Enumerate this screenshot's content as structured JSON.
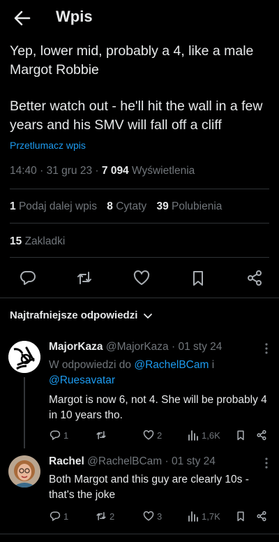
{
  "header": {
    "title": "Wpis",
    "back_icon": "arrow-left-icon"
  },
  "post": {
    "paragraphs": [
      "Yep, lower mid, probably a 4, like a male Margot Robbie",
      "Better watch out - he'll hit the wall in a few years and his SMV will fall off a cliff"
    ],
    "translate_label": "Przetlumacz wpis",
    "time": "14:40",
    "date": "31 gru 23",
    "views_count": "7 094",
    "views_label": "Wyświetlenia",
    "reposts_count": "1",
    "reposts_label": "Podaj dalej wpis",
    "quotes_count": "8",
    "quotes_label": "Cytaty",
    "likes_count": "39",
    "likes_label": "Polubienia",
    "bookmarks_count": "15",
    "bookmarks_label": "Zakladki"
  },
  "sort": {
    "label": "Najtrafniejsze odpowiedzi"
  },
  "replies": [
    {
      "name": "MajorKaza",
      "handle": "@MajorKaza",
      "date": "01 sty 24",
      "reply_to_prefix": "W odpowiedzi do",
      "mention_1": "@RachelBCam",
      "joiner": "i",
      "mention_2": "@Ruesavatar",
      "text": "Margot is now 6, not 4. She will be probably 4 in 10 years tho.",
      "replies": "1",
      "reposts": "",
      "likes": "2",
      "views": "1,6K"
    },
    {
      "name": "Rachel",
      "handle": "@RachelBCam",
      "date": "01 sty 24",
      "text": "Both Margot and this guy are clearly 10s - that's the joke",
      "replies": "1",
      "reposts": "2",
      "likes": "3",
      "views": "1,7K"
    }
  ],
  "colors": {
    "background": "#000000",
    "text": "#e7e9ea",
    "muted": "#71767b",
    "link": "#1d9bf0",
    "divider": "#2f3336"
  }
}
